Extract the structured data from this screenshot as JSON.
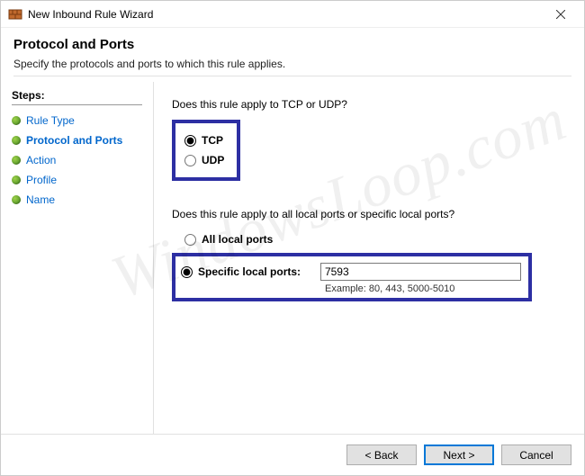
{
  "window": {
    "title": "New Inbound Rule Wizard"
  },
  "header": {
    "heading": "Protocol and Ports",
    "subtitle": "Specify the protocols and ports to which this rule applies."
  },
  "sidebar": {
    "title": "Steps:",
    "items": [
      {
        "label": "Rule Type"
      },
      {
        "label": "Protocol and Ports"
      },
      {
        "label": "Action"
      },
      {
        "label": "Profile"
      },
      {
        "label": "Name"
      }
    ],
    "active_index": 1
  },
  "main": {
    "protocol_question": "Does this rule apply to TCP or UDP?",
    "protocol": {
      "tcp_label": "TCP",
      "udp_label": "UDP",
      "selected": "tcp"
    },
    "ports_question": "Does this rule apply to all local ports or specific local ports?",
    "ports": {
      "all_label": "All local ports",
      "specific_label": "Specific local ports:",
      "selected": "specific",
      "value": "7593",
      "example": "Example: 80, 443, 5000-5010"
    }
  },
  "footer": {
    "back": "< Back",
    "next": "Next >",
    "cancel": "Cancel"
  },
  "watermark": "WindowsLoop.com"
}
